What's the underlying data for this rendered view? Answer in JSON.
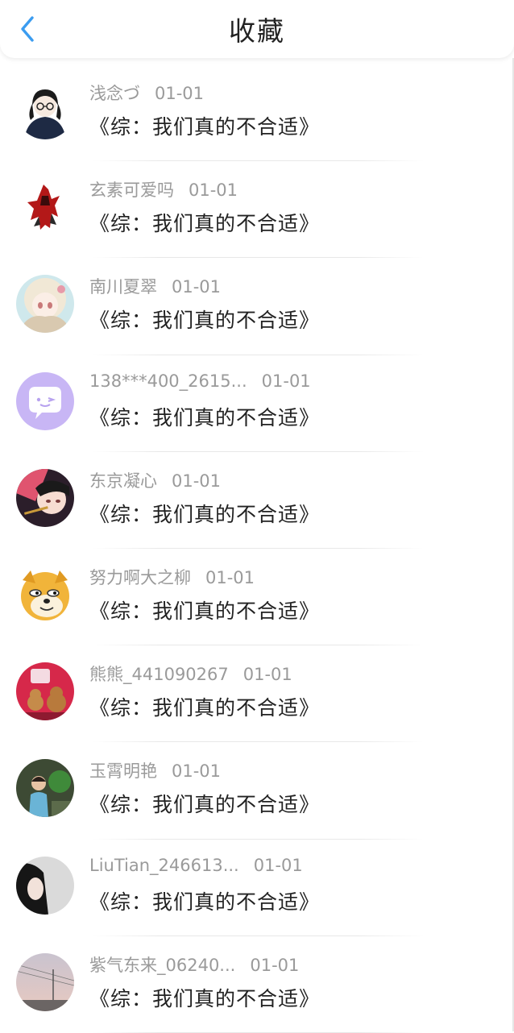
{
  "header": {
    "title": "收藏",
    "back_icon": "chevron-left-icon",
    "accent": "#3b9cf0"
  },
  "items": [
    {
      "user": "浅念づ",
      "date": "01-01",
      "book": "《综：我们真的不合适》",
      "avatar_icon": "avatar-girl-glasses-icon"
    },
    {
      "user": "玄素可爱吗",
      "date": "01-01",
      "book": "《综：我们真的不合适》",
      "avatar_icon": "avatar-red-robot-icon"
    },
    {
      "user": "南川夏翠",
      "date": "01-01",
      "book": "《综：我们真的不合适》",
      "avatar_icon": "avatar-anime-girl-icon"
    },
    {
      "user": "138***400_2615...",
      "date": "01-01",
      "book": "《综：我们真的不合适》",
      "avatar_icon": "avatar-chat-bubble-icon"
    },
    {
      "user": "东京凝心",
      "date": "01-01",
      "book": "《综：我们真的不合适》",
      "avatar_icon": "avatar-anime-boy-icon"
    },
    {
      "user": "努力啊大之柳",
      "date": "01-01",
      "book": "《综：我们真的不合适》",
      "avatar_icon": "avatar-doge-icon"
    },
    {
      "user": "熊熊_441090267",
      "date": "01-01",
      "book": "《综：我们真的不合适》",
      "avatar_icon": "avatar-teddy-bear-icon"
    },
    {
      "user": "玉霄明艳",
      "date": "01-01",
      "book": "《综：我们真的不合适》",
      "avatar_icon": "avatar-child-photo-icon"
    },
    {
      "user": "LiuTian_246613...",
      "date": "01-01",
      "book": "《综：我们真的不合适》",
      "avatar_icon": "avatar-woman-photo-icon"
    },
    {
      "user": "紫气东来_06240...",
      "date": "01-01",
      "book": "《综：我们真的不合适》",
      "avatar_icon": "avatar-sky-photo-icon"
    }
  ]
}
